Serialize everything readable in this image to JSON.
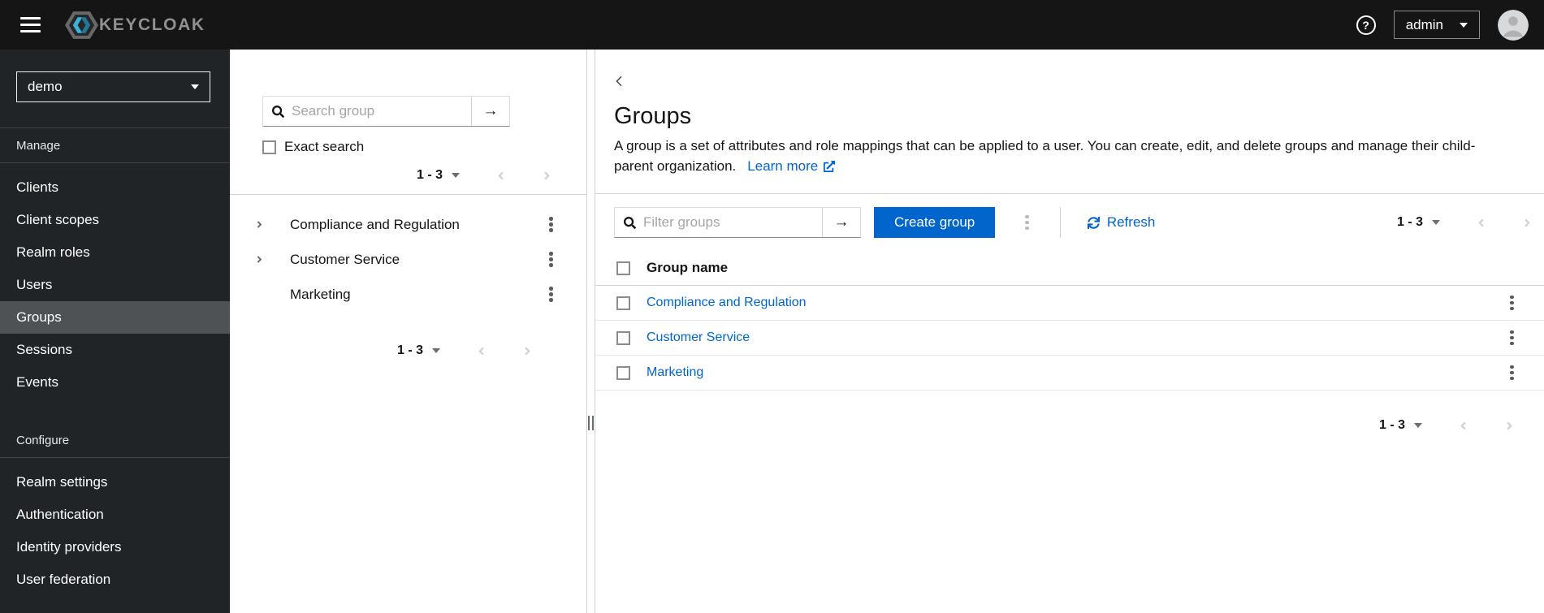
{
  "topbar": {
    "brand": "KEYCLOAK",
    "help_glyph": "?",
    "username": "admin"
  },
  "sidebar": {
    "realm": "demo",
    "active_item": "Groups",
    "sections": [
      {
        "label": "Manage",
        "items": [
          "Clients",
          "Client scopes",
          "Realm roles",
          "Users",
          "Groups",
          "Sessions",
          "Events"
        ]
      },
      {
        "label": "Configure",
        "items": [
          "Realm settings",
          "Authentication",
          "Identity providers",
          "User federation"
        ]
      }
    ]
  },
  "tree_panel": {
    "search_placeholder": "Search group",
    "search_submit_glyph": "→",
    "exact_search_label": "Exact search",
    "top_pagination": {
      "range": "1 - 3"
    },
    "items": [
      {
        "label": "Compliance and Regulation",
        "expandable": true
      },
      {
        "label": "Customer Service",
        "expandable": true
      },
      {
        "label": "Marketing",
        "expandable": false
      }
    ],
    "bottom_pagination": {
      "range": "1 - 3"
    }
  },
  "main": {
    "title": "Groups",
    "description": "A group is a set of attributes and role mappings that can be applied to a user. You can create, edit, and delete groups and manage their child-parent organization.",
    "learn_more_label": "Learn more",
    "toolbar": {
      "filter_placeholder": "Filter groups",
      "filter_submit_glyph": "→",
      "create_button_label": "Create group",
      "refresh_label": "Refresh",
      "pagination": {
        "range": "1 - 3"
      }
    },
    "table": {
      "header": "Group name",
      "rows": [
        {
          "name": "Compliance and Regulation"
        },
        {
          "name": "Customer Service"
        },
        {
          "name": "Marketing"
        }
      ]
    },
    "bottom_pagination": {
      "range": "1 - 3"
    }
  },
  "colors": {
    "primary": "#0066cc",
    "link": "#0066cc",
    "masthead_bg": "#151515",
    "sidebar_bg": "#212427",
    "sidebar_active_bg": "#4f5255",
    "border": "#d2d2d2"
  }
}
